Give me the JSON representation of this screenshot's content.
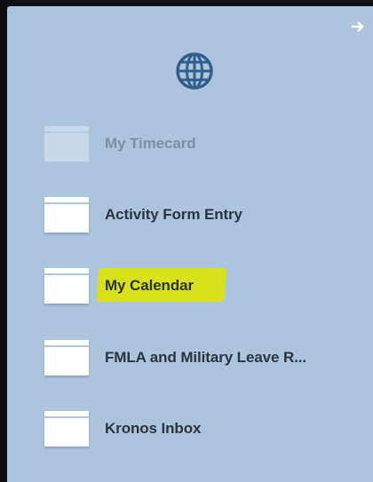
{
  "panel": {
    "collapse_icon": "arrow-right-icon",
    "globe_icon": "globe-icon"
  },
  "nav": {
    "items": [
      {
        "label": "My Timecard",
        "state": "disabled"
      },
      {
        "label": "Activity Form Entry",
        "state": "normal"
      },
      {
        "label": "My Calendar",
        "state": "highlighted",
        "highlight_color": "#d8e21c"
      },
      {
        "label": "FMLA and Military Leave R...",
        "state": "normal"
      },
      {
        "label": "Kronos Inbox",
        "state": "normal"
      }
    ]
  },
  "colors": {
    "panel_bg": "#aec4dc",
    "text": "#2c3440",
    "text_disabled": "#7d8fa4",
    "icon": "#2e5f8e"
  }
}
